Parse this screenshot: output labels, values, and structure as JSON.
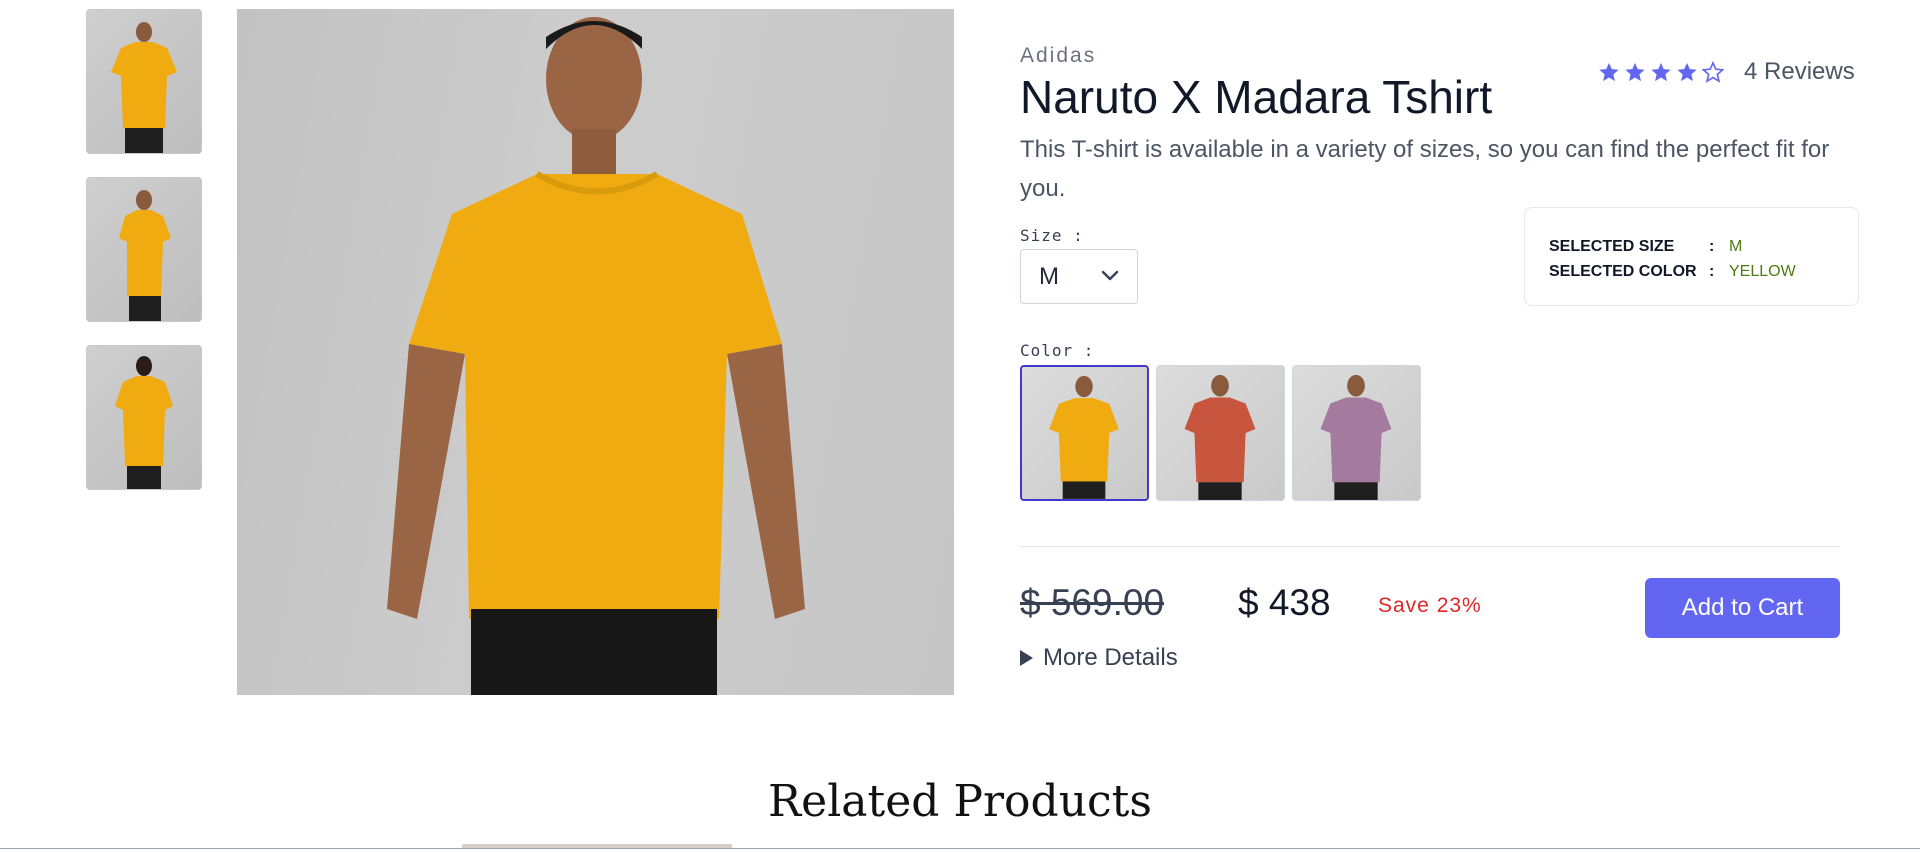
{
  "colors": {
    "accent": "#6366f1",
    "star": "#6366f1",
    "save_text": "#dc2626",
    "selected_value": "#4d7c0f",
    "shirt_yellow": "#f0ab10",
    "shirt_red": "#c8553d",
    "shirt_purple": "#a57a9f"
  },
  "gallery": {
    "thumbnails": [
      {
        "icon": "model-front-photo"
      },
      {
        "icon": "model-side-photo"
      },
      {
        "icon": "model-back-photo"
      }
    ],
    "main_image_icon": "model-yellow-tshirt-photo"
  },
  "product": {
    "brand": "Adidas",
    "title": "Naruto X Madara Tshirt",
    "rating": 4,
    "rating_max": 5,
    "reviews_label": "4 Reviews",
    "description": "This T-shirt is available in a variety of sizes, so you can find the perfect fit for you."
  },
  "size": {
    "label": "Size :",
    "selected": "M"
  },
  "color": {
    "label": "Color :",
    "swatches": [
      {
        "name": "yellow",
        "active": true
      },
      {
        "name": "red",
        "active": false
      },
      {
        "name": "purple",
        "active": false
      }
    ]
  },
  "selection": {
    "size_key": "SELECTED SIZE",
    "size_value": "M",
    "color_key": "SELECTED COLOR",
    "color_value": "YELLOW",
    "colon": ":"
  },
  "pricing": {
    "old_price": "$ 569.00",
    "new_price": "$ 438",
    "save": "Save 23%",
    "add_to_cart": "Add to Cart",
    "more_details": "More Details"
  },
  "related": {
    "heading": "Related Products"
  }
}
